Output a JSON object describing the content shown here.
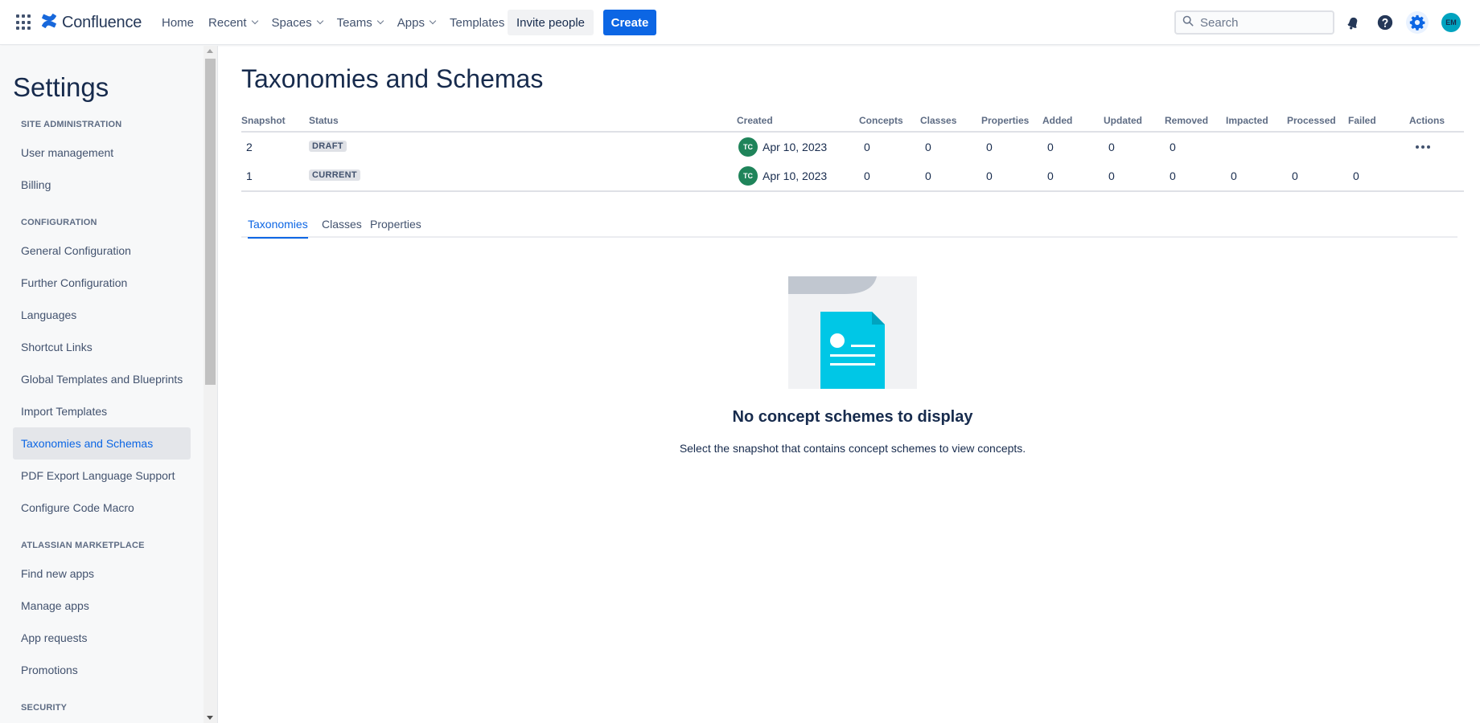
{
  "topnav": {
    "brand": "Confluence",
    "items": [
      {
        "label": "Home",
        "dropdown": false
      },
      {
        "label": "Recent",
        "dropdown": true
      },
      {
        "label": "Spaces",
        "dropdown": true
      },
      {
        "label": "Teams",
        "dropdown": true
      },
      {
        "label": "Apps",
        "dropdown": true
      },
      {
        "label": "Templates",
        "dropdown": false
      }
    ],
    "invite_label": "Invite people",
    "create_label": "Create",
    "search_placeholder": "Search",
    "avatar_initials": "EM",
    "icons": [
      "app-switcher-icon",
      "confluence-logo-icon",
      "search-icon",
      "notifications-icon",
      "help-icon",
      "settings-gear-icon"
    ]
  },
  "sidebar": {
    "title": "Settings",
    "sections": [
      {
        "heading": "SITE ADMINISTRATION",
        "items": [
          "User management",
          "Billing"
        ]
      },
      {
        "heading": "CONFIGURATION",
        "items": [
          "General Configuration",
          "Further Configuration",
          "Languages",
          "Shortcut Links",
          "Global Templates and Blueprints",
          "Import Templates",
          "Taxonomies and Schemas",
          "PDF Export Language Support",
          "Configure Code Macro"
        ]
      },
      {
        "heading": "ATLASSIAN MARKETPLACE",
        "items": [
          "Find new apps",
          "Manage apps",
          "App requests",
          "Promotions"
        ]
      },
      {
        "heading": "SECURITY",
        "items": []
      }
    ],
    "active_item": "Taxonomies and Schemas"
  },
  "main": {
    "title": "Taxonomies and Schemas",
    "table": {
      "columns": [
        "Snapshot",
        "Status",
        "Created",
        "Concepts",
        "Classes",
        "Properties",
        "Added",
        "Updated",
        "Removed",
        "Impacted",
        "Processed",
        "Failed",
        "Actions"
      ],
      "rows": [
        {
          "snapshot": "2",
          "status": "DRAFT",
          "creator_initials": "TC",
          "created": "Apr 10, 2023",
          "concepts": "0",
          "classes": "0",
          "properties": "0",
          "added": "0",
          "updated": "0",
          "removed": "0",
          "impacted": "",
          "processed": "",
          "failed": "",
          "has_actions": true
        },
        {
          "snapshot": "1",
          "status": "CURRENT",
          "creator_initials": "TC",
          "created": "Apr 10, 2023",
          "concepts": "0",
          "classes": "0",
          "properties": "0",
          "added": "0",
          "updated": "0",
          "removed": "0",
          "impacted": "0",
          "processed": "0",
          "failed": "0",
          "has_actions": false
        }
      ]
    },
    "tabs": [
      {
        "label": "Taxonomies",
        "active": true
      },
      {
        "label": "Classes",
        "active": false
      },
      {
        "label": "Properties",
        "active": false
      }
    ],
    "empty_state": {
      "title": "No concept schemes to display",
      "description": "Select the snapshot that contains concept schemes to view concepts."
    }
  },
  "colors": {
    "primary": "#0c66e4",
    "text": "#172b4d",
    "subtle_text": "#42526e",
    "sidebar_bg": "#f7f8f9",
    "avatar_tc": "#1f845a",
    "avatar_em": "#00a3bf",
    "illustration_doc": "#00c7e6"
  }
}
